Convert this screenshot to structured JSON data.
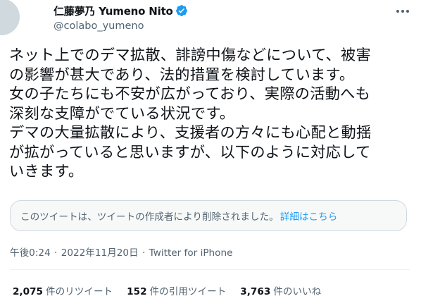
{
  "author": {
    "display_name": "仁藤夢乃 Yumeno Nito",
    "handle": "@colabo_yumeno",
    "verified_icon": "verified-badge-icon",
    "verified_color": "#1d9bf0"
  },
  "tweet": {
    "text": "ネット上でのデマ拡散、誹謗中傷などについて、被害\nの影響が甚大であり、法的措置を検討しています。\n女の子たちにも不安が広がっており、実際の活動へも\n深刻な支障がでている状況です。\nデマの大量拡散により、支援者の方々にも心配と動揺\nが拡がっていると思いますが、以下のように対応して\nいきます。"
  },
  "quoted": {
    "text": "このツイートは、ツイートの作成者により削除されました。",
    "link_label": "詳細はこちら"
  },
  "meta": {
    "time": "午後0:24",
    "separator": "·",
    "date": "2022年11月20日",
    "source": "Twitter for iPhone"
  },
  "stats": [
    {
      "value": "2,075",
      "label": "件のリツイート"
    },
    {
      "value": "152",
      "label": "件の引用ツイート"
    },
    {
      "value": "3,763",
      "label": "件のいいね"
    }
  ],
  "colors": {
    "text_primary": "#0f1419",
    "text_secondary": "#536471",
    "accent": "#1d9bf0",
    "border": "#cfd9de"
  }
}
